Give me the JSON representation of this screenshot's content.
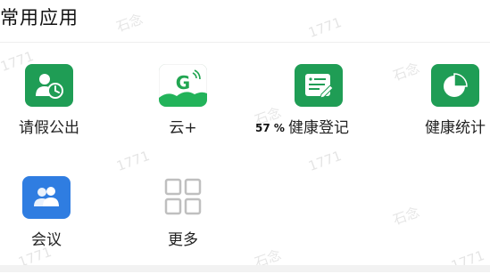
{
  "section": {
    "title": "常用应用"
  },
  "apps": [
    {
      "label": "请假公出",
      "icon": "leave-icon"
    },
    {
      "label": "云+",
      "icon": "cloud-plus-icon"
    },
    {
      "label": "健康登记",
      "icon": "health-register-icon"
    },
    {
      "label": "健康统计",
      "icon": "health-stats-icon"
    },
    {
      "label": "会议",
      "icon": "meeting-icon"
    },
    {
      "label": "更多",
      "icon": "more-grid-icon"
    }
  ],
  "overlay": {
    "zoom_text": "57 %"
  },
  "watermark": {
    "name": "石念",
    "id": "1771"
  },
  "colors": {
    "green": "#1f9d55",
    "blue": "#2f7de1",
    "more_gray": "#bfbfbf"
  }
}
